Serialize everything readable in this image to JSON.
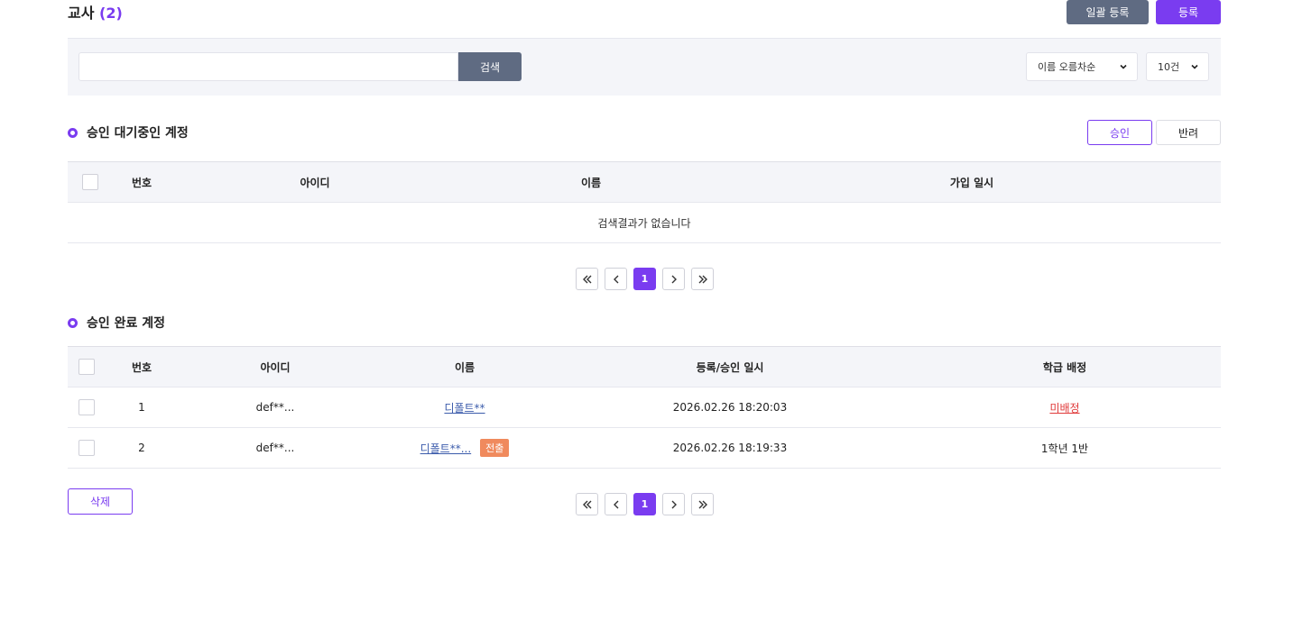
{
  "header": {
    "title": "교사",
    "count_open": "(",
    "count": "2",
    "count_close": ")",
    "bulk_register_label": "일괄 등록",
    "register_label": "등록"
  },
  "search": {
    "value": "",
    "placeholder": "",
    "button_label": "검색",
    "sort_selected": "이름 오름차순",
    "size_selected": "10건"
  },
  "pending": {
    "title": "승인 대기중인 계정",
    "approve_label": "승인",
    "reject_label": "반려",
    "columns": [
      "번호",
      "아이디",
      "이름",
      "가입 일시"
    ],
    "empty_message": "검색결과가 없습니다"
  },
  "approved": {
    "title": "승인 완료 계정",
    "columns": [
      "번호",
      "아이디",
      "이름",
      "등록/승인 일시",
      "학급 배정"
    ],
    "rows": [
      {
        "no": "1",
        "id": "def**...",
        "name": "디폴트**",
        "badge": "",
        "date": "2026.02.26 18:20:03",
        "class": "미배정"
      },
      {
        "no": "2",
        "id": "def**...",
        "name": "디폴트**...",
        "badge": "전출",
        "date": "2026.02.26 18:19:33",
        "class": "1학년 1반"
      }
    ],
    "delete_label": "삭제"
  },
  "pagination": {
    "current": "1"
  },
  "colors": {
    "accent": "#7a3cf0",
    "secondary": "#5f6b82",
    "badge": "#f08a5d",
    "warning_link": "#e03a3a"
  }
}
